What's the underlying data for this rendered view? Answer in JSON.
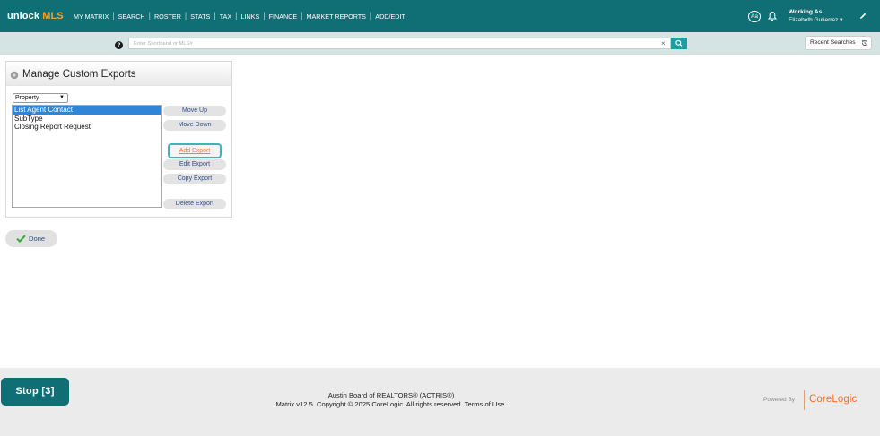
{
  "brand": {
    "prefix": "unlock",
    "suffix": "MLS"
  },
  "nav": {
    "items": [
      "MY MATRIX",
      "SEARCH",
      "ROSTER",
      "STATS",
      "TAX",
      "LINKS",
      "FINANCE",
      "MARKET REPORTS",
      "ADD/EDIT"
    ],
    "aa_label": "Aa",
    "working_as_label": "Working As",
    "user_name": "Elizabeth Gutierrez"
  },
  "search": {
    "placeholder": "Enter Shorthand or MLS#",
    "value": "",
    "clear_glyph": "×",
    "recent_label": "Recent Searches",
    "help_glyph": "?"
  },
  "panel": {
    "title": "Manage Custom Exports",
    "type_selected": "Property",
    "exports": [
      "List Agent Contact",
      "SubType",
      "Closing Report Request"
    ],
    "selected_index": 0,
    "buttons": {
      "move_up": "Move Up",
      "move_down": "Move Down",
      "add": "Add Export",
      "edit": "Edit Export",
      "copy": "Copy Export",
      "delete": "Delete Export"
    }
  },
  "done_label": "Done",
  "footer": {
    "org": "Austin Board of REALTORS® (ACTRIS®)",
    "copyright": "Matrix v12.5. Copyright © 2025 CoreLogic. All rights reserved.",
    "terms": "Terms of Use.",
    "powered_by": "Powered By",
    "logo_text": "CoreLogic"
  },
  "stop_label": "Stop [3]",
  "colors": {
    "nav_bg": "#0f6f74",
    "searchbar_bg": "#d6e3e3",
    "accent": "#1d9ea0",
    "orange": "#ff7a2a",
    "selection": "#2f86d9"
  }
}
